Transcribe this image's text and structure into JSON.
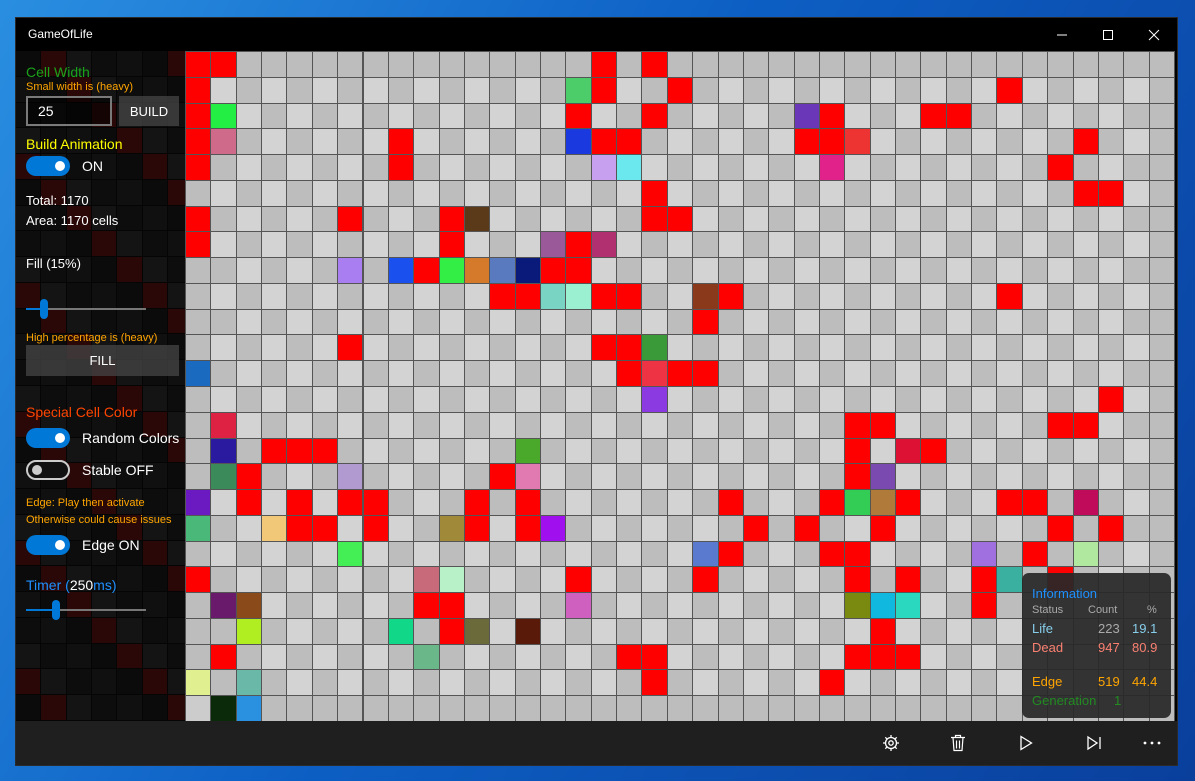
{
  "window": {
    "title": "GameOfLife"
  },
  "sidebar": {
    "cell_width_label": "Cell Width",
    "cell_width_hint": "Small width is (heavy)",
    "cell_width_value": "25",
    "build_button": "BUILD",
    "build_animation_label": "Build Animation",
    "build_animation_state": "ON",
    "total_text": "Total: 1170",
    "area_text": "Area: 1170 cells",
    "fill_prefix": "Fill (",
    "fill_value": "15",
    "fill_suffix": "%)",
    "fill_hint": "High percentage is (heavy)",
    "fill_button": "FILL",
    "special_color_label": "Special Cell Color",
    "random_colors_label": "Random Colors",
    "stable_label": "Stable OFF",
    "edge_hint_1": "Edge: Play then activate",
    "edge_hint_2": "Otherwise could cause issues",
    "edge_label": "Edge ON",
    "timer_prefix": "Timer (",
    "timer_value": "250",
    "timer_suffix": "ms)",
    "fill_slider_fraction": 0.15,
    "timer_slider_fraction": 0.25
  },
  "info": {
    "title": "Information",
    "col_status": "Status",
    "col_count": "Count",
    "col_percent": "%",
    "life_label": "Life",
    "life_count": "223",
    "life_percent": "19.1",
    "dead_label": "Dead",
    "dead_count": "947",
    "dead_percent": "80.9",
    "edge_label": "Edge",
    "edge_count": "519",
    "edge_percent": "44.4",
    "generation_label": "Generation",
    "generation_value": "1"
  },
  "appbar": {
    "icons": [
      "settings-icon",
      "delete-icon",
      "play-icon",
      "step-forward-icon",
      "more-icon"
    ]
  },
  "colors": {
    "cell_alive": "#ff0000",
    "cell_dead": "#d3d3d3",
    "cell_edge": "#bdbdbd",
    "accent": "#0078d7",
    "cell_width_label": "#1aa31a",
    "hint_orange": "#ffa500",
    "build_animation_label": "#ffff00",
    "special_color_label": "#ff4500",
    "timer_label": "#1e90ff",
    "info_title": "#1e90ff",
    "life": "#87ceeb",
    "dead": "#fa8072",
    "edge": "#ffa500",
    "generation": "#228b22"
  },
  "grid": {
    "columns": 39,
    "rows": 26,
    "live_cells": [
      [
        0,
        0,
        "#ff0000"
      ],
      [
        0,
        1,
        "#ff0000"
      ],
      [
        0,
        16,
        "#ff0000"
      ],
      [
        0,
        18,
        "#ff0000"
      ],
      [
        1,
        0,
        "#ff0000"
      ],
      [
        1,
        15,
        "#4ccd6a"
      ],
      [
        1,
        16,
        "#ff0000"
      ],
      [
        1,
        19,
        "#ff0000"
      ],
      [
        1,
        32,
        "#ff0000"
      ],
      [
        2,
        0,
        "#ff0000"
      ],
      [
        2,
        1,
        "#22ee44"
      ],
      [
        2,
        15,
        "#ff0000"
      ],
      [
        2,
        18,
        "#ff0000"
      ],
      [
        2,
        24,
        "#6a37b8"
      ],
      [
        2,
        25,
        "#ff0000"
      ],
      [
        2,
        29,
        "#ff0000"
      ],
      [
        2,
        30,
        "#ff0000"
      ],
      [
        3,
        0,
        "#ff0000"
      ],
      [
        3,
        1,
        "#d06a8a"
      ],
      [
        3,
        8,
        "#ff0000"
      ],
      [
        3,
        15,
        "#1a3ae0"
      ],
      [
        3,
        16,
        "#ff0000"
      ],
      [
        3,
        17,
        "#ff0000"
      ],
      [
        3,
        24,
        "#ff0000"
      ],
      [
        3,
        25,
        "#ff0000"
      ],
      [
        3,
        26,
        "#ee3333"
      ],
      [
        3,
        35,
        "#ff0000"
      ],
      [
        4,
        0,
        "#ff0000"
      ],
      [
        4,
        8,
        "#ff0000"
      ],
      [
        4,
        16,
        "#c8a0f0"
      ],
      [
        4,
        17,
        "#6ae8ee"
      ],
      [
        4,
        25,
        "#e0228a"
      ],
      [
        4,
        34,
        "#ff0000"
      ],
      [
        5,
        18,
        "#ff0000"
      ],
      [
        5,
        35,
        "#ff0000"
      ],
      [
        5,
        36,
        "#ff0000"
      ],
      [
        6,
        0,
        "#ff0000"
      ],
      [
        6,
        6,
        "#ff0000"
      ],
      [
        6,
        10,
        "#ff0000"
      ],
      [
        6,
        11,
        "#5a3a18"
      ],
      [
        6,
        18,
        "#ff0000"
      ],
      [
        6,
        19,
        "#ff0000"
      ],
      [
        7,
        0,
        "#ff0000"
      ],
      [
        7,
        10,
        "#ff0000"
      ],
      [
        7,
        14,
        "#9a5a9a"
      ],
      [
        7,
        15,
        "#ff0000"
      ],
      [
        7,
        16,
        "#b03070"
      ],
      [
        8,
        6,
        "#a87ef0"
      ],
      [
        8,
        8,
        "#1a50ee"
      ],
      [
        8,
        9,
        "#ff0000"
      ],
      [
        8,
        10,
        "#33ee44"
      ],
      [
        8,
        11,
        "#d47a2a"
      ],
      [
        8,
        12,
        "#5a7ac0"
      ],
      [
        8,
        13,
        "#0a1a7a"
      ],
      [
        8,
        14,
        "#ff0000"
      ],
      [
        8,
        15,
        "#ff0000"
      ],
      [
        9,
        12,
        "#ff0000"
      ],
      [
        9,
        13,
        "#ff0000"
      ],
      [
        9,
        14,
        "#7ad4c4"
      ],
      [
        9,
        15,
        "#9af0d0"
      ],
      [
        9,
        16,
        "#ff0000"
      ],
      [
        9,
        17,
        "#ff0000"
      ],
      [
        9,
        20,
        "#8a3a1a"
      ],
      [
        9,
        21,
        "#ff0000"
      ],
      [
        9,
        32,
        "#ff0000"
      ],
      [
        10,
        20,
        "#ff0000"
      ],
      [
        11,
        6,
        "#ff0000"
      ],
      [
        11,
        16,
        "#ff0000"
      ],
      [
        11,
        17,
        "#ff0000"
      ],
      [
        11,
        18,
        "#3a9a3a"
      ],
      [
        12,
        0,
        "#1a6ac0"
      ],
      [
        12,
        17,
        "#ff0000"
      ],
      [
        12,
        18,
        "#ee3344"
      ],
      [
        12,
        19,
        "#ff0000"
      ],
      [
        12,
        20,
        "#ff0000"
      ],
      [
        13,
        18,
        "#8a3ae0"
      ],
      [
        13,
        36,
        "#ff0000"
      ],
      [
        14,
        1,
        "#dd2244"
      ],
      [
        14,
        26,
        "#ff0000"
      ],
      [
        14,
        27,
        "#ff0000"
      ],
      [
        14,
        34,
        "#ff0000"
      ],
      [
        14,
        35,
        "#ff0000"
      ],
      [
        15,
        1,
        "#2a1aa0"
      ],
      [
        15,
        3,
        "#ff0000"
      ],
      [
        15,
        4,
        "#ff0000"
      ],
      [
        15,
        5,
        "#ff0000"
      ],
      [
        15,
        13,
        "#4aa82a"
      ],
      [
        15,
        26,
        "#ff0000"
      ],
      [
        15,
        28,
        "#dd1133"
      ],
      [
        15,
        29,
        "#ff0000"
      ],
      [
        16,
        1,
        "#3a8a5a"
      ],
      [
        16,
        2,
        "#ff0000"
      ],
      [
        16,
        6,
        "#b09ad0"
      ],
      [
        16,
        12,
        "#ff0000"
      ],
      [
        16,
        13,
        "#e07ab0"
      ],
      [
        16,
        26,
        "#ff0000"
      ],
      [
        16,
        27,
        "#7a4ab0"
      ],
      [
        17,
        0,
        "#6a1ac0"
      ],
      [
        17,
        2,
        "#ff0000"
      ],
      [
        17,
        4,
        "#ff0000"
      ],
      [
        17,
        6,
        "#ff0000"
      ],
      [
        17,
        7,
        "#ff0000"
      ],
      [
        17,
        11,
        "#ff0000"
      ],
      [
        17,
        13,
        "#ff0000"
      ],
      [
        17,
        21,
        "#ff0000"
      ],
      [
        17,
        25,
        "#ff0000"
      ],
      [
        17,
        26,
        "#33cc55"
      ],
      [
        17,
        27,
        "#b07a3a"
      ],
      [
        17,
        28,
        "#ff0000"
      ],
      [
        17,
        32,
        "#ff0000"
      ],
      [
        17,
        33,
        "#ff0000"
      ],
      [
        17,
        35,
        "#c00a5a"
      ],
      [
        18,
        0,
        "#4ab878"
      ],
      [
        18,
        3,
        "#f0c878"
      ],
      [
        18,
        4,
        "#ff0000"
      ],
      [
        18,
        5,
        "#ff0000"
      ],
      [
        18,
        7,
        "#ff0000"
      ],
      [
        18,
        10,
        "#a08a3a"
      ],
      [
        18,
        11,
        "#ff0000"
      ],
      [
        18,
        13,
        "#ff0000"
      ],
      [
        18,
        14,
        "#a010ee"
      ],
      [
        18,
        22,
        "#ff0000"
      ],
      [
        18,
        24,
        "#ff0000"
      ],
      [
        18,
        27,
        "#ff0000"
      ],
      [
        18,
        34,
        "#ff0000"
      ],
      [
        18,
        36,
        "#ff0000"
      ],
      [
        19,
        6,
        "#44ee55"
      ],
      [
        19,
        20,
        "#5a7ad0"
      ],
      [
        19,
        21,
        "#ff0000"
      ],
      [
        19,
        25,
        "#ff0000"
      ],
      [
        19,
        26,
        "#ff0000"
      ],
      [
        19,
        31,
        "#a070e0"
      ],
      [
        19,
        33,
        "#ff0000"
      ],
      [
        19,
        35,
        "#b0e8a0"
      ],
      [
        20,
        0,
        "#ff0000"
      ],
      [
        20,
        9,
        "#c86a7a"
      ],
      [
        20,
        10,
        "#b8f0c8"
      ],
      [
        20,
        15,
        "#ff0000"
      ],
      [
        20,
        20,
        "#ff0000"
      ],
      [
        20,
        26,
        "#ff0000"
      ],
      [
        20,
        28,
        "#ff0000"
      ],
      [
        20,
        31,
        "#ff0000"
      ],
      [
        20,
        32,
        "#3ab0a0"
      ],
      [
        20,
        34,
        "#ff0000"
      ],
      [
        21,
        1,
        "#6a1a6a"
      ],
      [
        21,
        2,
        "#8a4a1a"
      ],
      [
        21,
        9,
        "#ff0000"
      ],
      [
        21,
        10,
        "#ff0000"
      ],
      [
        21,
        15,
        "#d060c0"
      ],
      [
        21,
        26,
        "#7a8a10"
      ],
      [
        21,
        27,
        "#10b8e0"
      ],
      [
        21,
        28,
        "#2ad8c0"
      ],
      [
        21,
        31,
        "#ff0000"
      ],
      [
        22,
        2,
        "#b0ee22"
      ],
      [
        22,
        8,
        "#10d888"
      ],
      [
        22,
        10,
        "#ff0000"
      ],
      [
        22,
        11,
        "#6a6a3a"
      ],
      [
        22,
        13,
        "#5a1a0a"
      ],
      [
        22,
        27,
        "#ff0000"
      ],
      [
        23,
        1,
        "#ff0000"
      ],
      [
        23,
        9,
        "#6ab88a"
      ],
      [
        23,
        17,
        "#ff0000"
      ],
      [
        23,
        18,
        "#ff0000"
      ],
      [
        23,
        26,
        "#ff0000"
      ],
      [
        23,
        27,
        "#ff0000"
      ],
      [
        23,
        28,
        "#ff0000"
      ],
      [
        24,
        0,
        "#e0f090"
      ],
      [
        24,
        2,
        "#6ab8a8"
      ],
      [
        24,
        18,
        "#ff0000"
      ],
      [
        24,
        25,
        "#ff0000"
      ],
      [
        25,
        0,
        "#cccccc"
      ],
      [
        25,
        1,
        "#0a2a0a"
      ],
      [
        25,
        2,
        "#2a90e0"
      ]
    ]
  }
}
